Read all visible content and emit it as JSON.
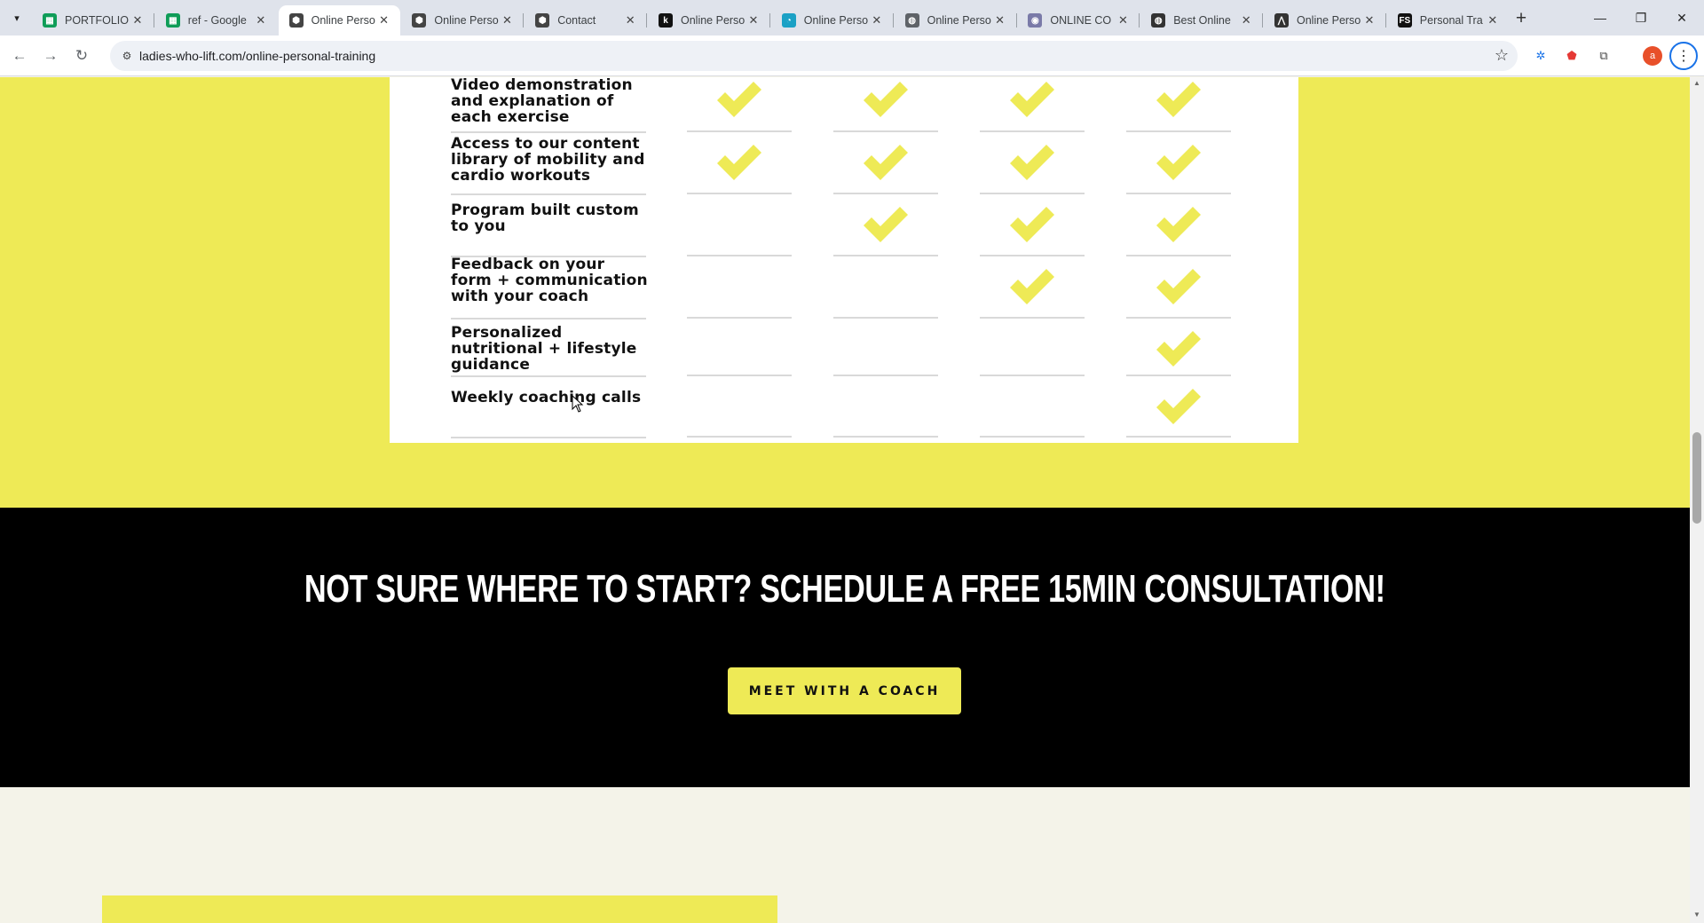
{
  "browser": {
    "tabs": [
      {
        "title": "PORTFOLIO ·",
        "icon": "sheets-icon",
        "color": "#0f9d58"
      },
      {
        "title": "ref - Google",
        "icon": "sheets-icon",
        "color": "#0f9d58"
      },
      {
        "title": "Online Perso",
        "icon": "cube-icon",
        "color": "#444444",
        "active": true
      },
      {
        "title": "Online Perso",
        "icon": "cube-icon",
        "color": "#444444"
      },
      {
        "title": "Contact",
        "icon": "cube-icon",
        "color": "#444444"
      },
      {
        "title": "Online Perso",
        "icon": "k-logo-icon",
        "color": "#111111"
      },
      {
        "title": "Online Perso",
        "icon": "chart-logo-icon",
        "color": "#1ba1c5"
      },
      {
        "title": "Online Perso",
        "icon": "globe-icon",
        "color": "#5f6368"
      },
      {
        "title": "ONLINE CO",
        "icon": "circle-logo-icon",
        "color": "#7a7aa8"
      },
      {
        "title": "Best Online",
        "icon": "globe-icon",
        "color": "#333333"
      },
      {
        "title": "Online Perso",
        "icon": "mountain-logo-icon",
        "color": "#333333"
      },
      {
        "title": "Personal Tra",
        "icon": "fs-logo-icon",
        "color": "#111111"
      }
    ],
    "url": "ladies-who-lift.com/online-personal-training",
    "profile_initial": "a"
  },
  "comparison": {
    "features": [
      {
        "label": "Video demonstration and explanation of each exercise",
        "checks": [
          true,
          true,
          true,
          true
        ]
      },
      {
        "label": "Access to our content library of mobility and cardio workouts",
        "checks": [
          true,
          true,
          true,
          true
        ]
      },
      {
        "label": "Program built custom to you",
        "checks": [
          false,
          true,
          true,
          true
        ]
      },
      {
        "label": "Feedback on your form + communication with your coach",
        "checks": [
          false,
          false,
          true,
          true
        ]
      },
      {
        "label": "Personalized nutritional + lifestyle guidance",
        "checks": [
          false,
          false,
          false,
          true
        ]
      },
      {
        "label": "Weekly coaching calls",
        "checks": [
          false,
          false,
          false,
          true
        ]
      }
    ],
    "check_color": "#eeea56"
  },
  "cta": {
    "heading": "NOT SURE WHERE TO START? SCHEDULE A FREE 15MIN CONSULTATION!",
    "button_label": "MEET WITH A COACH"
  },
  "colors": {
    "brand_yellow": "#eeea56",
    "cta_background": "#000000",
    "page_background": "#f4f3e9"
  }
}
